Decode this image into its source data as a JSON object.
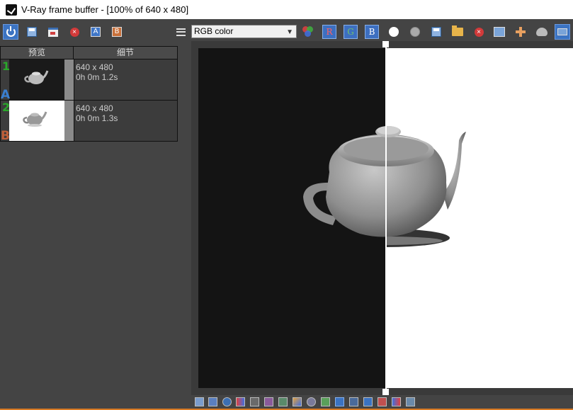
{
  "window": {
    "title": "V-Ray frame buffer - [100% of 640 x 480]"
  },
  "toolbar": {
    "channel_selected": "RGB color",
    "channel_r": "R",
    "channel_g": "G",
    "channel_b": "B",
    "compare_a": "A",
    "compare_b": "B"
  },
  "history": {
    "col_preview": "预览",
    "col_details": "细节",
    "items": [
      {
        "index": "1",
        "ab": "A",
        "size": "640 x 480",
        "time": "0h 0m 1.2s"
      },
      {
        "index": "2",
        "ab": "B",
        "size": "640 x 480",
        "time": "0h 0m 1.3s"
      }
    ]
  },
  "colors": {
    "accent_blue": "#3b73c2",
    "history_index": "#2aa82a",
    "label_a": "#3a7fd0",
    "label_b": "#c0603a",
    "bottom_accent": "#d87a24"
  }
}
